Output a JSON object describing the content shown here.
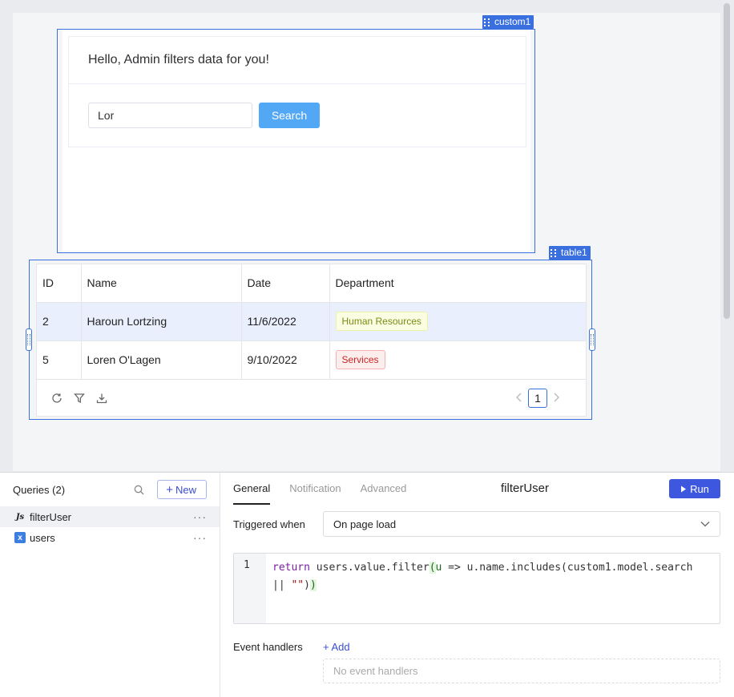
{
  "canvas": {
    "custom1": {
      "tag": "custom1",
      "greeting": "Hello, Admin filters data for you!",
      "search_value": "Lor",
      "search_button": "Search"
    },
    "table1": {
      "tag": "table1",
      "columns": [
        "ID",
        "Name",
        "Date",
        "Department"
      ],
      "rows": [
        {
          "id": "2",
          "name": "Haroun Lortzing",
          "date": "11/6/2022",
          "department": "Human Resources",
          "tag_color": "#7b8a11"
        },
        {
          "id": "5",
          "name": "Loren O'Lagen",
          "date": "9/10/2022",
          "department": "Services",
          "tag_color": "#cf2323"
        }
      ],
      "current_page": "1",
      "footer_icons": [
        "refresh-icon",
        "filter-icon",
        "download-icon"
      ]
    }
  },
  "queries": {
    "title": "Queries (2)",
    "new_label": "New",
    "items": [
      {
        "name": "filterUser",
        "icon": "js-icon"
      },
      {
        "name": "users",
        "icon": "variable-icon"
      }
    ]
  },
  "editor": {
    "tabs": [
      "General",
      "Notification",
      "Advanced"
    ],
    "query_name": "filterUser",
    "run_label": "Run",
    "triggered_label": "Triggered when",
    "triggered_value": "On page load",
    "line_number": "1",
    "code": {
      "kw": "return",
      "a": " users.value.filter",
      "b": "(",
      "c": "u",
      "d": " => u.name.includes(custom1.model.search\n|| ",
      "e": "\"\"",
      "f": ")",
      "g": ")"
    },
    "event_handlers_label": "Event handlers",
    "add_label": "Add",
    "no_handlers": "No event handlers"
  },
  "colors": {
    "accent": "#3d58de",
    "selection": "#3a6fe0",
    "search_button": "#53a8f5"
  }
}
